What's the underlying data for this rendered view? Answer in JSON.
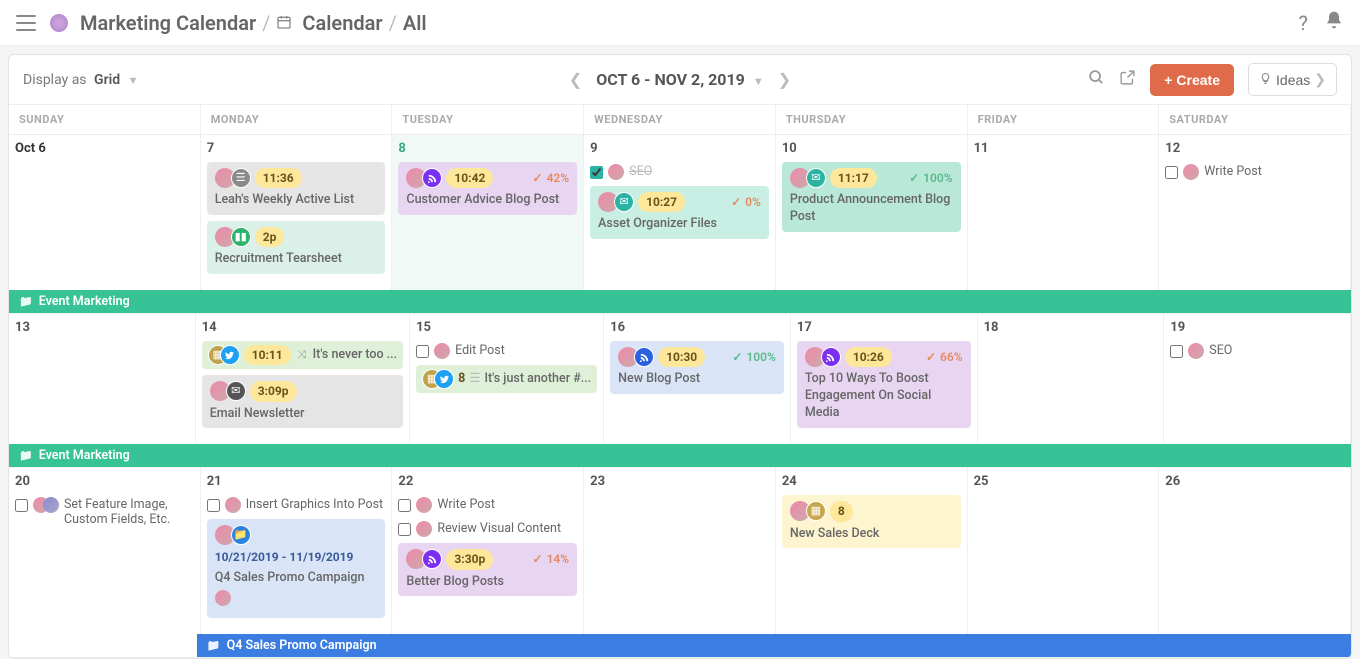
{
  "breadcrumb": {
    "workspace": "Marketing Calendar",
    "section": "Calendar",
    "view": "All"
  },
  "toolbar": {
    "display_label": "Display as",
    "display_value": "Grid",
    "range": "OCT 6 - NOV 2, 2019",
    "create": "Create",
    "ideas": "Ideas"
  },
  "dayheaders": [
    "SUNDAY",
    "MONDAY",
    "TUESDAY",
    "WEDNESDAY",
    "THURSDAY",
    "FRIDAY",
    "SATURDAY"
  ],
  "swimlanes": {
    "event_marketing": "Event Marketing",
    "sales_promo": "Q4 Sales Promo Campaign"
  },
  "dates": {
    "w1": [
      "Oct 6",
      "7",
      "8",
      "9",
      "10",
      "11",
      "12"
    ],
    "w2": [
      "13",
      "14",
      "15",
      "16",
      "17",
      "18",
      "19"
    ],
    "w3": [
      "20",
      "21",
      "22",
      "23",
      "24",
      "25",
      "26"
    ]
  },
  "cards": {
    "mon1a": {
      "time": "11:36",
      "title": "Leah's Weekly Active List"
    },
    "mon1b": {
      "time": "2p",
      "title": "Recruitment Tearsheet"
    },
    "tue1": {
      "time": "10:42",
      "pct": "42%",
      "title": "Customer Advice Blog Post"
    },
    "wed1_task": {
      "label": "SEO"
    },
    "wed1": {
      "time": "10:27",
      "pct": "0%",
      "title": "Asset Organizer Files"
    },
    "thu1": {
      "time": "11:17",
      "pct": "100%",
      "title": "Product Announcement Blog Post"
    },
    "sat1_task": {
      "label": "Write Post"
    },
    "mon2a": {
      "time": "10:11",
      "title": "It's never too ..."
    },
    "mon2b": {
      "time": "3:09p",
      "title": "Email Newsletter"
    },
    "tue2_task": {
      "label": "Edit Post"
    },
    "tue2": {
      "count": "8",
      "title": "It's just another #..."
    },
    "wed2": {
      "time": "10:30",
      "pct": "100%",
      "title": "New Blog Post"
    },
    "thu2": {
      "time": "10:26",
      "pct": "66%",
      "title": "Top 10 Ways To Boost Engagement On Social Media"
    },
    "sat2_task": {
      "label": "SEO"
    },
    "sun3_task": {
      "label": "Set Feature Image, Custom Fields, Etc."
    },
    "mon3_task": {
      "label": "Insert Graphics Into Post"
    },
    "mon3": {
      "daterange": "10/21/2019 - 11/19/2019",
      "title": "Q4 Sales Promo Campaign"
    },
    "tue3_task1": {
      "label": "Write Post"
    },
    "tue3_task2": {
      "label": "Review Visual Content"
    },
    "tue3": {
      "time": "3:30p",
      "pct": "14%",
      "title": "Better Blog Posts"
    },
    "thu3": {
      "count": "8",
      "title": "New Sales Deck"
    }
  }
}
